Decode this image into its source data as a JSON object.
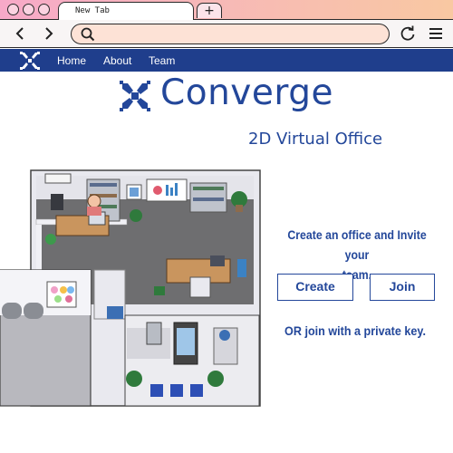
{
  "browser": {
    "tab_title": "New Tab",
    "new_tab_symbol": "+",
    "window_controls": [
      "close-dot",
      "minimize-dot",
      "maximize-dot"
    ],
    "address": "",
    "icons": [
      "back-arrow-icon",
      "forward-arrow-icon",
      "search-icon",
      "reload-icon",
      "menu-icon"
    ]
  },
  "site_nav": {
    "links": [
      "Home",
      "About",
      "Team"
    ]
  },
  "hero": {
    "brand": "Converge",
    "tagline": "2D Virtual Office"
  },
  "cta": {
    "line1": "Create an office and Invite your",
    "line2": "team.",
    "create_label": "Create",
    "join_label": "Join",
    "private_key_text": "OR join with a private key."
  },
  "colors": {
    "brand_blue": "#23479a",
    "nav_blue": "#1f3e8c",
    "tabbar_gradient": [
      "#f7a9c8",
      "#f9c8a2"
    ],
    "urlbar_fill": "#fde2d6"
  }
}
